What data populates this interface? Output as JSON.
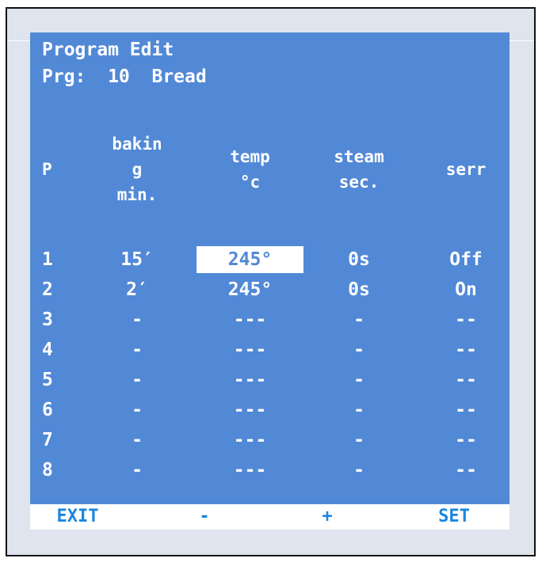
{
  "screen": {
    "title": "Program Edit",
    "program_line": "Prg:  10  Bread"
  },
  "table": {
    "headers": {
      "p": "P",
      "baking": "bakin\ng\nmin.",
      "temp": "temp\n°c",
      "steam": "steam\nsec.",
      "serr": "serr"
    },
    "rows": [
      {
        "p": "1",
        "baking": "15′",
        "temp": "245°",
        "steam": "0s",
        "serr": "Off"
      },
      {
        "p": "2",
        "baking": "2′",
        "temp": "245°",
        "steam": "0s",
        "serr": "On"
      },
      {
        "p": "3",
        "baking": "-",
        "temp": "---",
        "steam": "-",
        "serr": "--"
      },
      {
        "p": "4",
        "baking": "-",
        "temp": "---",
        "steam": "-",
        "serr": "--"
      },
      {
        "p": "5",
        "baking": "-",
        "temp": "---",
        "steam": "-",
        "serr": "--"
      },
      {
        "p": "6",
        "baking": "-",
        "temp": "---",
        "steam": "-",
        "serr": "--"
      },
      {
        "p": "7",
        "baking": "-",
        "temp": "---",
        "steam": "-",
        "serr": "--"
      },
      {
        "p": "8",
        "baking": "-",
        "temp": "---",
        "steam": "-",
        "serr": "--"
      }
    ]
  },
  "softkeys": {
    "exit": "EXIT",
    "minus": "-",
    "plus": "+",
    "set": "SET"
  },
  "colors": {
    "screen_bg": "#5289d6",
    "softkey_text": "#1a86e0",
    "frame_bg": "#dfe4ee"
  }
}
